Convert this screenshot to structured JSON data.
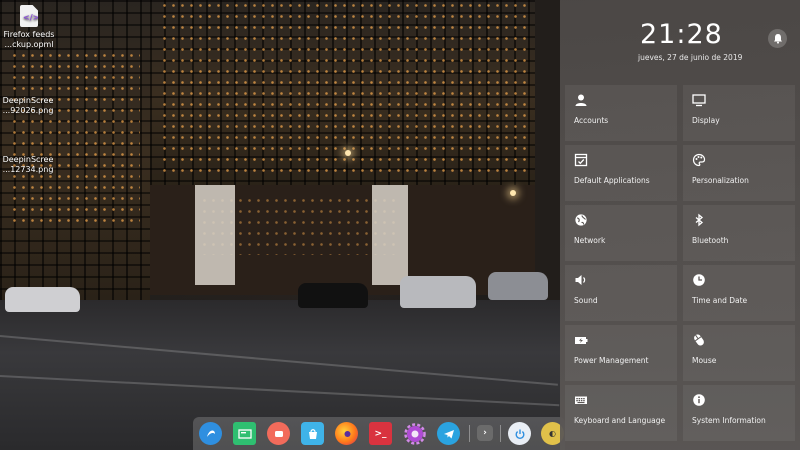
{
  "desktop": {
    "icons": [
      {
        "label_1": "Firefox feeds",
        "label_2": "...ckup.opml"
      },
      {
        "label_1": "DeepinScree",
        "label_2": "...92026.png"
      },
      {
        "label_1": "DeepinScree",
        "label_2": "...12734.png"
      }
    ]
  },
  "control_center": {
    "time": "21:28",
    "date": "jueves, 27 de junio de 2019",
    "tiles": [
      {
        "label": "Accounts",
        "icon": "user-icon"
      },
      {
        "label": "Display",
        "icon": "monitor-icon"
      },
      {
        "label": "Default Applications",
        "icon": "default-apps-icon"
      },
      {
        "label": "Personalization",
        "icon": "palette-icon"
      },
      {
        "label": "Network",
        "icon": "globe-icon"
      },
      {
        "label": "Bluetooth",
        "icon": "bluetooth-icon"
      },
      {
        "label": "Sound",
        "icon": "speaker-icon"
      },
      {
        "label": "Time and Date",
        "icon": "clock-icon"
      },
      {
        "label": "Power Management",
        "icon": "battery-icon"
      },
      {
        "label": "Mouse",
        "icon": "mouse-icon"
      },
      {
        "label": "Keyboard and Language",
        "icon": "keyboard-icon"
      },
      {
        "label": "System Information",
        "icon": "info-icon"
      }
    ]
  },
  "dock": {
    "items": [
      {
        "name": "launcher-icon",
        "color": "#2f8fe0"
      },
      {
        "name": "file-manager-icon",
        "color": "#2fbf71"
      },
      {
        "name": "screen-recorder-icon",
        "color": "#f26b5b"
      },
      {
        "name": "app-store-icon",
        "color": "#3fb3e8"
      },
      {
        "name": "firefox-icon",
        "color": "#ff7a1a"
      },
      {
        "name": "terminal-icon",
        "color": "#d9333f"
      },
      {
        "name": "settings-icon",
        "color": "#b04bd6"
      },
      {
        "name": "telegram-icon",
        "color": "#2aa3e0"
      },
      {
        "name": "show-more-icon",
        "color": "#6b6b6b"
      },
      {
        "name": "power-icon",
        "color": "#e9eef5"
      },
      {
        "name": "app-icon",
        "color": "#e0c14a"
      }
    ]
  }
}
